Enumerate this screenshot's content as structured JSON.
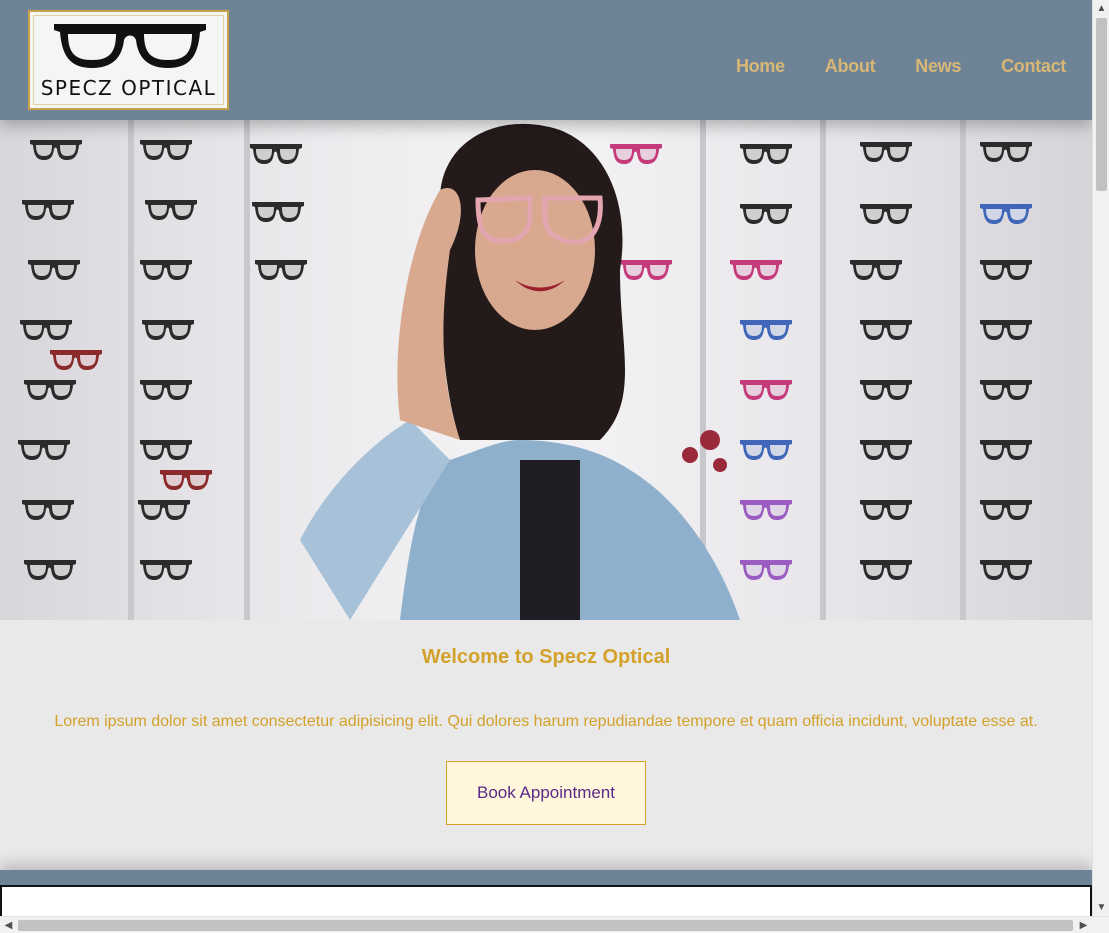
{
  "header": {
    "logo_text": "SPECZ OPTICAL",
    "nav": [
      {
        "label": "Home"
      },
      {
        "label": "About"
      },
      {
        "label": "News"
      },
      {
        "label": "Contact"
      }
    ]
  },
  "main": {
    "welcome": "Welcome to Specz Optical",
    "description": "Lorem ipsum dolor sit amet consectetur adipisicing elit. Qui dolores harum repudiandae tempore et quam officia incidunt, voluptate esse at.",
    "cta_label": "Book Appointment"
  },
  "colors": {
    "header_bg": "#6e8396",
    "nav_text": "#d8b776",
    "accent_gold": "#d4a12a",
    "button_bg": "#fff6dc",
    "button_text": "#5a2a86",
    "page_bg": "#e9e9e9"
  },
  "icons": {
    "logo": "eyeglasses-icon",
    "scroll_up": "chevron-up-icon",
    "scroll_down": "chevron-down-icon",
    "scroll_left": "chevron-left-icon",
    "scroll_right": "chevron-right-icon"
  }
}
